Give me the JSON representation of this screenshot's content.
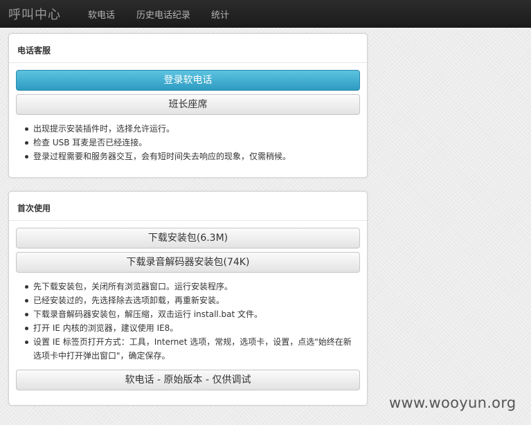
{
  "navbar": {
    "brand": "呼叫中心",
    "items": [
      "软电话",
      "历史电话纪录",
      "统计"
    ]
  },
  "phone_panel": {
    "title": "电话客服",
    "login_button": "登录软电话",
    "monitor_button": "班长座席",
    "tips": [
      "出现提示安装插件时，选择允许运行。",
      "检查 USB 耳麦是否已经连接。",
      "登录过程需要和服务器交互，会有短时间失去响应的现象，仅需稍候。"
    ]
  },
  "first_use_panel": {
    "title": "首次使用",
    "download_button": "下载安装包(6.3M)",
    "codec_button": "下载录音解码器安装包(74K)",
    "tips": [
      "先下载安装包，关闭所有浏览器窗口。运行安装程序。",
      "已经安装过的，先选择除去选项卸载，再重新安装。",
      "下载录音解码器安装包，解压缩，双击运行 install.bat 文件。",
      "打开 IE 内核的浏览器，建议使用 IE8。",
      "设置 IE 标签页打开方式：工具，Internet 选项，常规，选项卡，设置，点选\"始终在新选项卡中打开弹出窗口\"，确定保存。"
    ],
    "original_button": "软电话 - 原始版本 - 仅供调试"
  },
  "watermark": "www.wooyun.org"
}
